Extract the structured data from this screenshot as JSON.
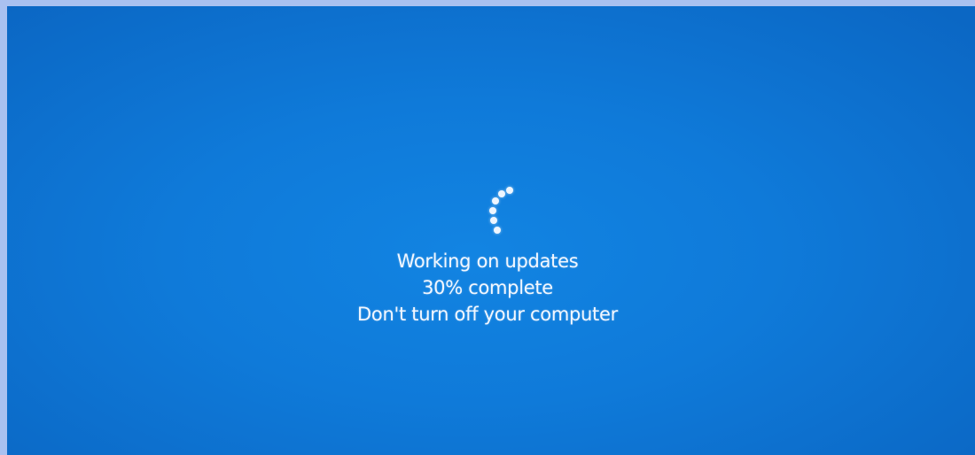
{
  "update_screen": {
    "status_line": "Working on updates",
    "progress_line": "30% complete",
    "warning_line": "Don't turn off your computer",
    "progress_percent": 30,
    "spinner_icon": "loading-spinner-icon"
  },
  "colors": {
    "background": "#0f7ad9",
    "text": "#f2f7ff",
    "border": "#a9c1f0"
  }
}
